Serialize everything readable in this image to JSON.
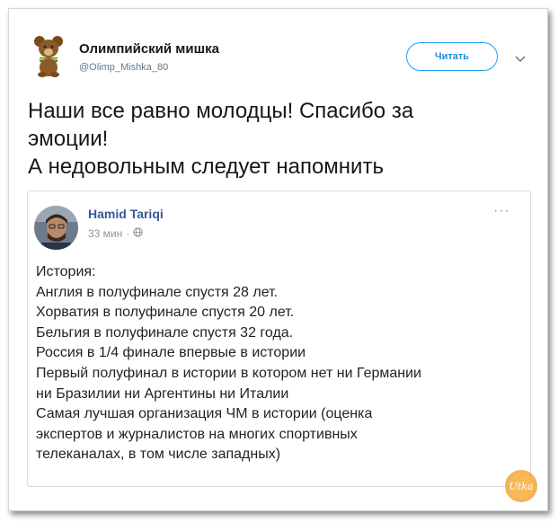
{
  "tweet": {
    "display_name": "Олимпийский мишка",
    "handle": "@Olimp_Mishka_80",
    "follow_label": "Читать",
    "text_lines": [
      "Наши все равно молодцы! Спасибо за",
      "эмоции!",
      "А недовольным следует напомнить"
    ]
  },
  "embedded_post": {
    "author": "Hamid Tariqi",
    "time": "33 мин",
    "more_label": "···",
    "lines": [
      "История:",
      "Англия в полуфинале спустя 28 лет.",
      "Хорватия в полуфинале спустя 20 лет.",
      "Бельгия в полуфинале спустя 32 года.",
      "Россия в 1/4 финале впервые в истории",
      "Первый полуфинал в истории в котором нет ни Германии",
      "ни Бразилии ни Аргентины ни Италии",
      "Самая лучшая организация ЧМ в истории (оценка",
      "экспертов и журналистов на многих спортивных",
      "телеканалах, в том числе западных)"
    ]
  },
  "watermark": {
    "text": "Utka"
  },
  "colors": {
    "link_blue": "#1da1f2",
    "fb_name_blue": "#365899",
    "text_dark": "#14171a",
    "meta_gray": "#657786"
  },
  "icons": [
    "bear-avatar-icon",
    "chevron-down-icon",
    "globe-icon",
    "more-options-icon"
  ]
}
